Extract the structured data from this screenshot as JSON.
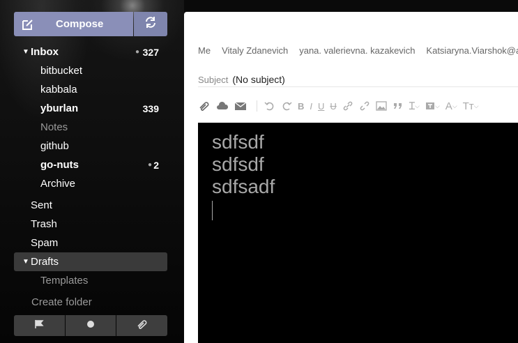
{
  "sidebar": {
    "compose_label": "Compose",
    "folders": [
      {
        "label": "Inbox",
        "count": "327",
        "has_dot": true
      },
      {
        "label": "bitbucket"
      },
      {
        "label": "kabbala"
      },
      {
        "label": "yburlan",
        "count": "339"
      },
      {
        "label": "Notes"
      },
      {
        "label": "github"
      },
      {
        "label": "go-nuts",
        "count": "2",
        "has_dot": true
      },
      {
        "label": "Archive"
      },
      {
        "label": "Sent"
      },
      {
        "label": "Trash"
      },
      {
        "label": "Spam"
      },
      {
        "label": "Drafts",
        "selected": true
      },
      {
        "label": "Templates"
      },
      {
        "label": "Create folder"
      }
    ],
    "bottom_buttons": [
      "flag-icon",
      "dot-icon",
      "attachment-icon"
    ]
  },
  "compose": {
    "recipients": [
      "Me",
      "Vitaly Zdanevich",
      "yana. valerievna. kazakevich",
      "Katsiaryna.Viarshok@a"
    ],
    "subject_label": "Subject",
    "subject_value": "(No subject)",
    "body_lines": [
      "sdfsdf",
      "sdfsdf",
      "sdfsadf"
    ]
  },
  "colors": {
    "compose_button": "#8a8fb8",
    "selected_folder": "#3a3a3a",
    "editor_bg": "#000000"
  }
}
